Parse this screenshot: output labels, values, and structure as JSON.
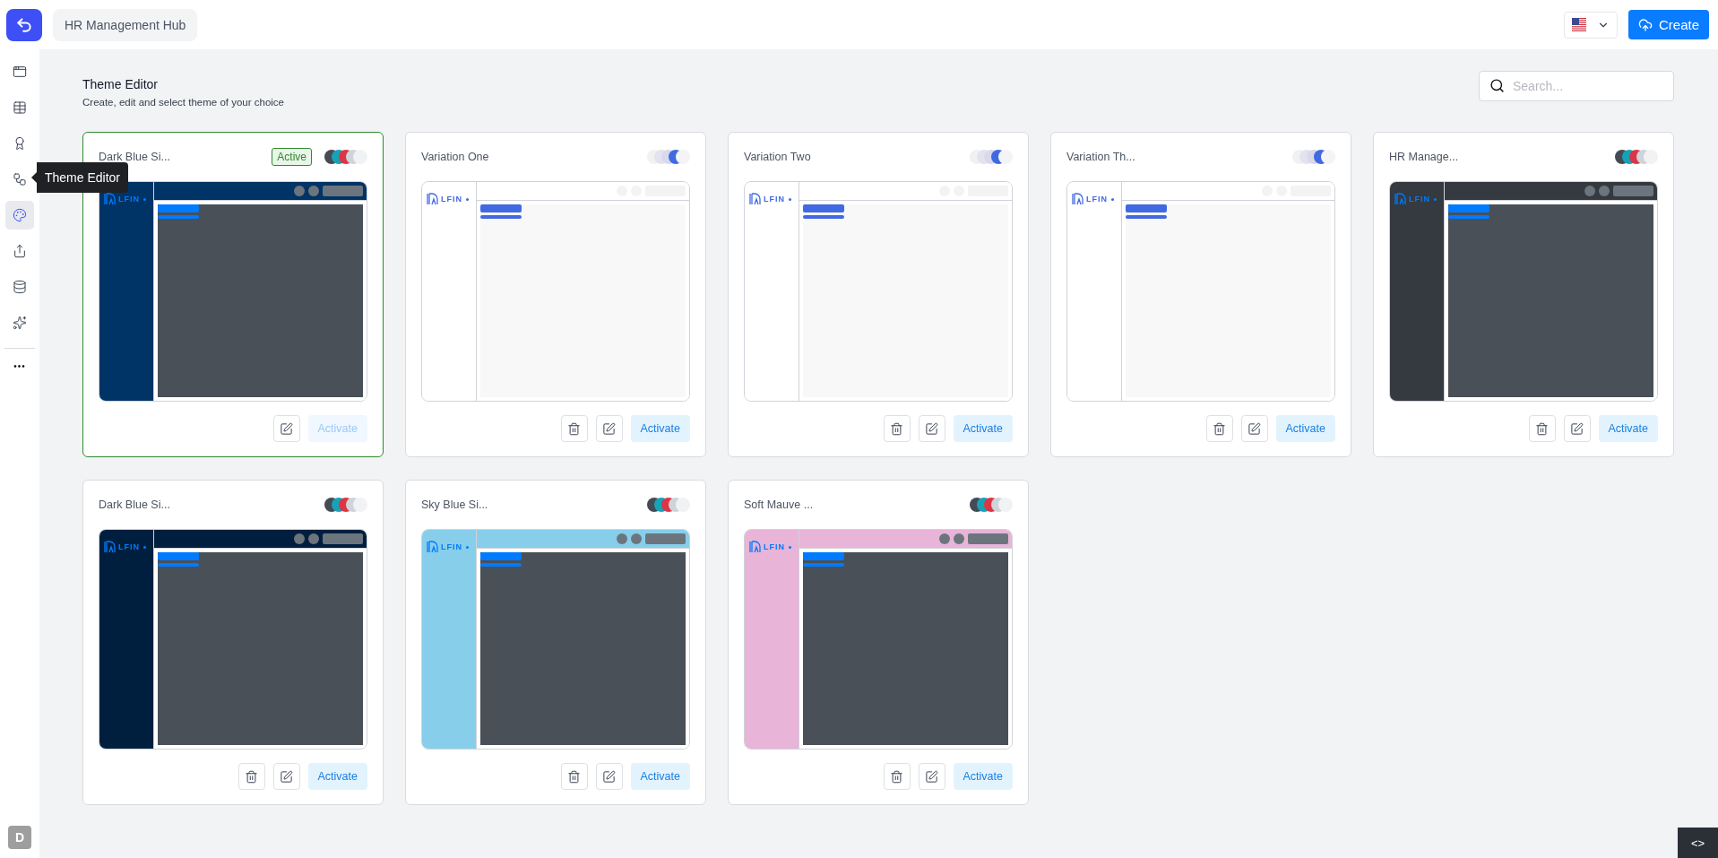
{
  "header": {
    "project": "HR Management Hub",
    "language": {
      "selected": true
    },
    "create_button": "Create"
  },
  "sidebar": {
    "items": [
      {
        "selected": false
      },
      {
        "selected": false
      },
      {
        "selected": false
      },
      {
        "selected": false
      },
      {
        "selected": true
      },
      {
        "selected": false
      },
      {
        "selected": false
      },
      {
        "selected": false
      }
    ],
    "more": "•••",
    "tooltip": "Theme Editor",
    "avatar": "D"
  },
  "page": {
    "title": "Theme Editor",
    "subtitle": "Create, edit and select theme of your choice",
    "search": {
      "placeholder": "Search..."
    }
  },
  "themes": [
    {
      "name": "Dark Blue Si...",
      "active": true,
      "badge": "Active",
      "deletable": false,
      "activate": "Activate",
      "logo": "LFIN",
      "swatches": [
        {
          "color": "#454b54"
        },
        {
          "color": "#17a2b8"
        },
        {
          "color": "#dc3545"
        },
        {
          "color": "#ced4da"
        },
        {
          "color": "#f1f2f4"
        }
      ],
      "preview": {
        "kind": "navy"
      }
    },
    {
      "name": "Variation One",
      "active": false,
      "deletable": true,
      "activate": "Activate",
      "logo": "LFIN",
      "swatches": [
        {
          "color": "#f1f1f4"
        },
        {
          "color": "#e3e3ef"
        },
        {
          "color": "#d9d9ec"
        },
        {
          "color": "#4169e1"
        },
        {
          "color": "#f4f4f6"
        }
      ],
      "preview": {
        "kind": "light"
      }
    },
    {
      "name": "Variation Two",
      "active": false,
      "deletable": true,
      "activate": "Activate",
      "logo": "LFIN",
      "swatches": [
        {
          "color": "#f1f1f4"
        },
        {
          "color": "#e3e3ef"
        },
        {
          "color": "#d9d9ec"
        },
        {
          "color": "#4169e1"
        },
        {
          "color": "#f4f4f6"
        }
      ],
      "preview": {
        "kind": "light"
      }
    },
    {
      "name": "Variation Th...",
      "active": false,
      "deletable": true,
      "activate": "Activate",
      "logo": "LFIN",
      "swatches": [
        {
          "color": "#f1f1f4"
        },
        {
          "color": "#e3e3ef"
        },
        {
          "color": "#d9d9ec"
        },
        {
          "color": "#4169e1"
        },
        {
          "color": "#f4f4f6"
        }
      ],
      "preview": {
        "kind": "light"
      }
    },
    {
      "name": "HR Manage...",
      "active": false,
      "deletable": true,
      "activate": "Activate",
      "logo": "LFIN",
      "swatches": [
        {
          "color": "#454b54"
        },
        {
          "color": "#17a2b8"
        },
        {
          "color": "#dc3545"
        },
        {
          "color": "#ced4da"
        },
        {
          "color": "#f1f2f4"
        }
      ],
      "preview": {
        "kind": "charcoal"
      }
    },
    {
      "name": "Dark Blue Si...",
      "active": false,
      "deletable": true,
      "activate": "Activate",
      "logo": "LFIN",
      "swatches": [
        {
          "color": "#454b54"
        },
        {
          "color": "#17a2b8"
        },
        {
          "color": "#dc3545"
        },
        {
          "color": "#ced4da"
        },
        {
          "color": "#f1f2f4"
        }
      ],
      "preview": {
        "kind": "midnight"
      }
    },
    {
      "name": "Sky Blue Si...",
      "active": false,
      "deletable": true,
      "activate": "Activate",
      "logo": "LFIN",
      "swatches": [
        {
          "color": "#454b54"
        },
        {
          "color": "#17a2b8"
        },
        {
          "color": "#dc3545"
        },
        {
          "color": "#ced4da"
        },
        {
          "color": "#f1f2f4"
        }
      ],
      "preview": {
        "kind": "sky"
      }
    },
    {
      "name": "Soft Mauve ...",
      "active": false,
      "deletable": true,
      "activate": "Activate",
      "logo": "LFIN",
      "swatches": [
        {
          "color": "#454b54"
        },
        {
          "color": "#17a2b8"
        },
        {
          "color": "#dc3545"
        },
        {
          "color": "#ced4da"
        },
        {
          "color": "#f1f2f4"
        }
      ],
      "preview": {
        "kind": "mauve"
      }
    }
  ],
  "code_toggle": "<>"
}
